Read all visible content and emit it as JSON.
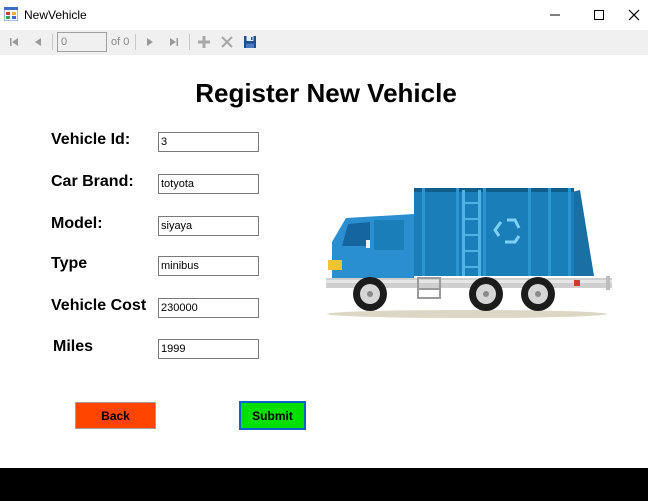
{
  "window": {
    "title": "NewVehicle"
  },
  "toolbar": {
    "position_value": "0",
    "count_label": "of 0"
  },
  "form": {
    "heading": "Register New Vehicle",
    "fields": {
      "vehicle_id": {
        "label": "Vehicle Id:",
        "value": "3"
      },
      "car_brand": {
        "label": "Car Brand:",
        "value": "totyota"
      },
      "model": {
        "label": "Model:",
        "value": "siyaya"
      },
      "type": {
        "label": "Type",
        "value": "minibus"
      },
      "vehicle_cost": {
        "label": "Vehicle Cost",
        "value": "230000"
      },
      "miles": {
        "label": "Miles",
        "value": "1999"
      }
    },
    "back_label": "Back",
    "submit_label": "Submit"
  },
  "colors": {
    "back_button": "#ff4500",
    "submit_button": "#00e000",
    "truck_body": "#1a7fb8",
    "truck_cab": "#2a8fd0"
  },
  "icons": [
    "app-icon",
    "move-first-icon",
    "move-previous-icon",
    "move-next-icon",
    "move-last-icon",
    "add-new-icon",
    "delete-icon",
    "save-icon",
    "minimize-icon",
    "maximize-icon",
    "close-icon"
  ]
}
